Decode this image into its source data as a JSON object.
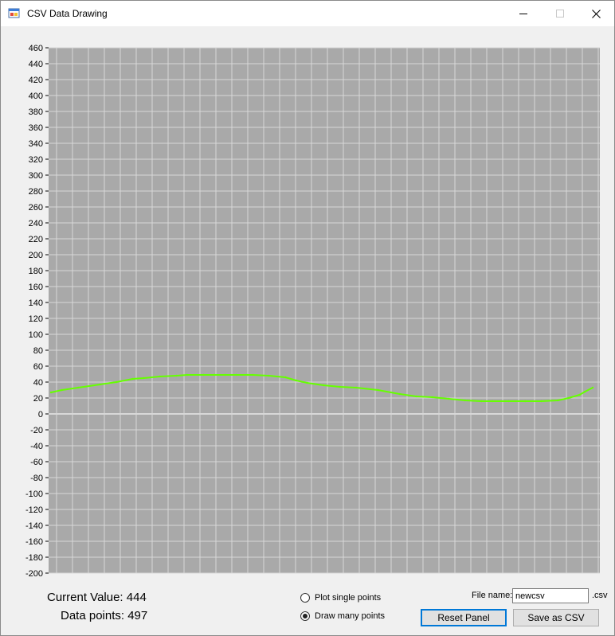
{
  "window": {
    "title": "CSV Data Drawing",
    "controls": {
      "minimize": "minimize",
      "maximize": "maximize",
      "close": "close"
    }
  },
  "chart_data": {
    "type": "line",
    "xlabel": "",
    "ylabel": "",
    "ylim": [
      -200,
      460
    ],
    "y_tick_step": 20,
    "xlim": [
      0,
      497
    ],
    "grid": true,
    "background": "#a9a9a9",
    "grid_color": "#d8d8d8",
    "line_color": "#66ff00",
    "series": [
      {
        "x": [
          0,
          10,
          25,
          45,
          60,
          75,
          85,
          100,
          115,
          125,
          140,
          150,
          160,
          170,
          180,
          185,
          200,
          215,
          225,
          235,
          250,
          265,
          280,
          300,
          320,
          335,
          350,
          365,
          380,
          395,
          405,
          420,
          435,
          450,
          465,
          475,
          485,
          490,
          497
        ],
        "y": [
          27,
          30,
          33,
          37,
          40,
          44,
          45,
          47,
          48,
          49,
          49,
          49,
          49,
          49,
          49,
          49,
          48,
          46,
          42,
          39,
          36,
          34,
          33,
          30,
          25,
          22,
          21,
          19,
          17,
          16,
          16,
          16,
          16,
          16,
          17,
          20,
          24,
          28,
          33
        ]
      }
    ]
  },
  "status": {
    "current_value_label": "Current Value: 444",
    "data_points_label": "Data points: 497"
  },
  "mode": {
    "single_label": "Plot single points",
    "many_label": "Draw many points",
    "selected": "many"
  },
  "file": {
    "name_label": "File name:",
    "name_value": "newcsv",
    "extension_label": ".csv"
  },
  "buttons": {
    "reset_label": "Reset Panel",
    "save_label": "Save as CSV"
  }
}
